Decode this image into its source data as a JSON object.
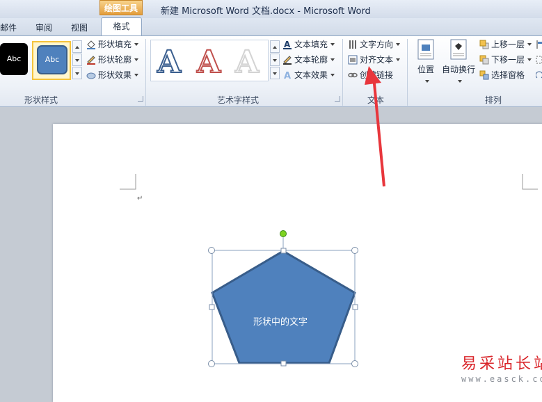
{
  "window": {
    "title": "新建 Microsoft Word 文档.docx  -  Microsoft Word",
    "context_tab_group": "绘图工具"
  },
  "tabs": [
    "邮件",
    "审阅",
    "视图",
    "格式"
  ],
  "active_tab": "格式",
  "ribbon": {
    "shape_styles": {
      "group_label": "形状样式",
      "gallery": [
        "Abc",
        "Abc"
      ],
      "fill": "形状填充",
      "outline": "形状轮廓",
      "effects": "形状效果"
    },
    "wordart_styles": {
      "group_label": "艺术字样式",
      "gallery": [
        "A",
        "A",
        "A"
      ],
      "text_fill": "文本填充",
      "text_outline": "文本轮廓",
      "text_effects": "文本效果"
    },
    "text": {
      "group_label": "文本",
      "direction": "文字方向",
      "align": "对齐文本",
      "link": "创建链接"
    },
    "arrange": {
      "group_label": "排列",
      "position": "位置",
      "wrap": "自动换行",
      "bring_forward": "上移一层",
      "send_backward": "下移一层",
      "selection_pane": "选择窗格"
    }
  },
  "document": {
    "paragraph_mark": "↵",
    "shape_text": "形状中的文字"
  },
  "watermark": {
    "text": "易采站长站",
    "url": "www.easck.com"
  },
  "colors": {
    "shape_fill": "#4f81bd",
    "shape_border": "#385d8a",
    "accent_orange": "#e39d3c",
    "annotation_arrow": "#e8363c",
    "rotation_handle": "#7ed321"
  }
}
